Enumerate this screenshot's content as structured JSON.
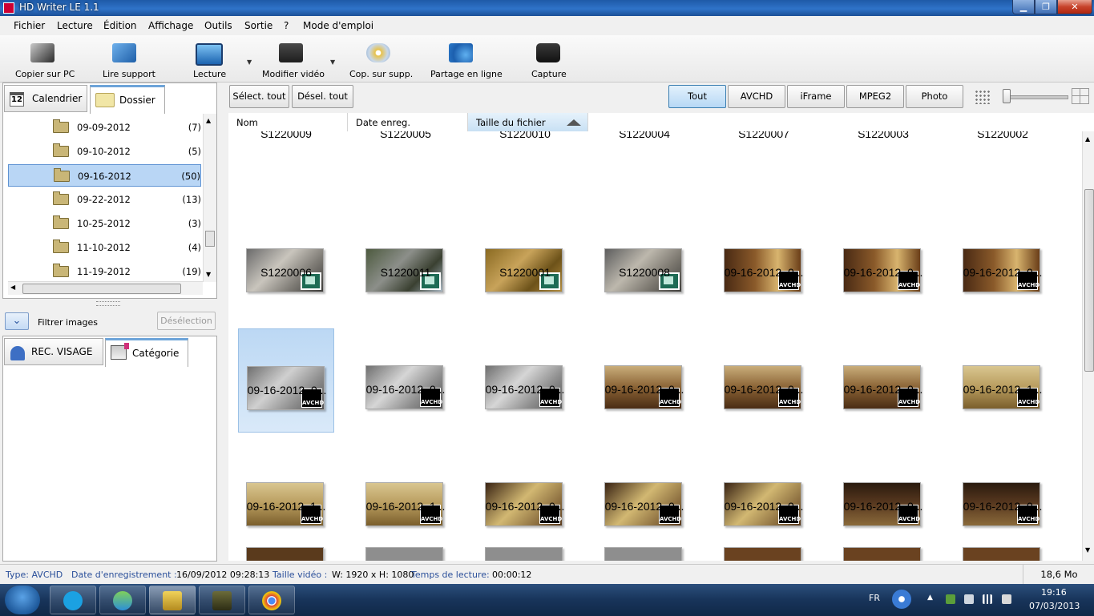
{
  "window": {
    "title": "HD Writer LE 1.1"
  },
  "menu": [
    "Fichier",
    "Lecture",
    "Édition",
    "Affichage",
    "Outils",
    "Sortie",
    "?",
    "Mode d'emploi"
  ],
  "toolbar": {
    "copy_pc": "Copier sur PC",
    "read_media": "Lire support",
    "play": "Lecture",
    "edit_video": "Modifier vidéo",
    "copy_media": "Cop. sur supp.",
    "share": "Partage en ligne",
    "capture": "Capture"
  },
  "left_tabs": {
    "calendar": "Calendrier",
    "calendar_icon_num": "12",
    "folder": "Dossier"
  },
  "folders": [
    {
      "name": "09-09-2012",
      "count": "(7)"
    },
    {
      "name": "09-10-2012",
      "count": "(5)"
    },
    {
      "name": "09-16-2012",
      "count": "(50)"
    },
    {
      "name": "09-22-2012",
      "count": "(13)"
    },
    {
      "name": "10-25-2012",
      "count": "(3)"
    },
    {
      "name": "11-10-2012",
      "count": "(4)"
    },
    {
      "name": "11-19-2012",
      "count": "(19)"
    }
  ],
  "filter": {
    "label": "Filtrer images",
    "deselect": "Désélection"
  },
  "bottom_tabs": {
    "face": "REC. VISAGE",
    "category": "Catégorie"
  },
  "selection": {
    "select_all": "Sélect. tout",
    "deselect_all": "Désel. tout"
  },
  "filters": [
    "Tout",
    "AVCHD",
    "iFrame",
    "MPEG2",
    "Photo"
  ],
  "columns": {
    "name": "Nom",
    "date": "Date enreg.",
    "size": "Taille du fichier"
  },
  "cut_row": [
    "S1220009",
    "S1220005",
    "S1220010",
    "S1220004",
    "S1220007",
    "S1220003",
    "S1220002"
  ],
  "grid_rows": [
    [
      "S1220006",
      "S1220011",
      "S1220001",
      "S1220008",
      "09-16-2012_0...",
      "09-16-2012_0...",
      "09-16-2012_0..."
    ],
    [
      "09-16-2012_0...",
      "09-16-2012_0...",
      "09-16-2012_0...",
      "09-16-2012_0...",
      "09-16-2012_0...",
      "09-16-2012_0...",
      "09-16-2012_1..."
    ],
    [
      "09-16-2012_1...",
      "09-16-2012_1...",
      "09-16-2012_0...",
      "09-16-2012_0...",
      "09-16-2012_0...",
      "09-16-2012_0...",
      "09-16-2012_0..."
    ]
  ],
  "badge_text": "AVCHD",
  "status": {
    "type": "Type: AVCHD",
    "date_label": "Date d'enregistrement :",
    "date_value": "16/09/2012 09:28:13",
    "size_label": "Taille vidéo :",
    "size_value": "W: 1920 x H: 1080",
    "duration_label": "Temps de lecture:",
    "duration_value": "00:00:12",
    "file_size": "18,6 Mo"
  },
  "taskbar": {
    "lang": "FR",
    "time": "19:16",
    "date": "07/03/2013"
  },
  "colors": {
    "accent": "#3c7fb1",
    "selection": "#b9d6f5",
    "titlebar": "#2f73c9"
  }
}
